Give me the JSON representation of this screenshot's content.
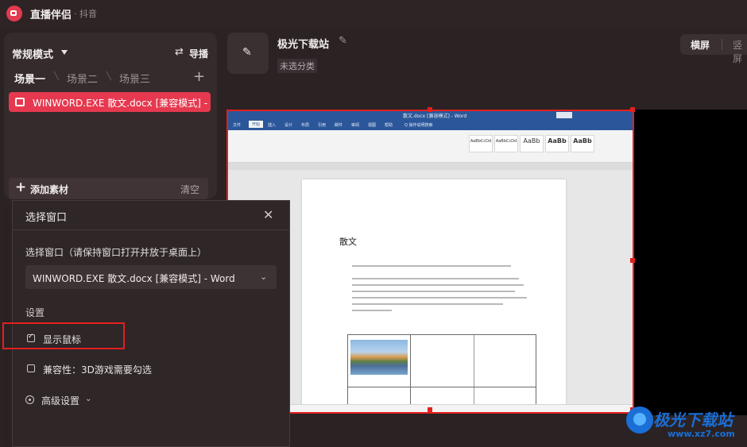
{
  "app": {
    "title": "直播伴侣",
    "platform": "· 抖音"
  },
  "mode": {
    "label": "常规模式"
  },
  "guide": {
    "label": "导播"
  },
  "scenes": [
    "场景一",
    "场景二",
    "场景三"
  ],
  "source": {
    "label": "WINWORD.EXE 散文.docx [兼容模式] - Word"
  },
  "add_bar": {
    "add_label": "添加素材",
    "clear_label": "清空"
  },
  "station": {
    "name": "极光下载站",
    "category": "未选分类"
  },
  "orientation": {
    "horizontal": "横屏",
    "vertical": "竖屏"
  },
  "word_preview": {
    "title": "散文.docx [兼容模式] - Word",
    "tabs": [
      "文件",
      "开始",
      "插入",
      "设计",
      "布局",
      "引用",
      "邮件",
      "审阅",
      "视图",
      "帮助",
      "Q 操作说明搜索"
    ],
    "styles": [
      "AaBbCcDd",
      "AaBbCcDd",
      "AaBb",
      "AaBb",
      "AaBb"
    ],
    "doc_title": "散文"
  },
  "dialog": {
    "title": "选择窗口",
    "select_label": "选择窗口（请保持窗口打开并放于桌面上）",
    "selected_window": "WINWORD.EXE 散文.docx [兼容模式] - Word",
    "settings_label": "设置",
    "show_cursor_label": "显示鼠标",
    "show_cursor_checked": true,
    "compat_label": "兼容性：3D游戏需要勾选",
    "compat_checked": false,
    "advanced_label": "高级设置"
  },
  "watermark": {
    "text": "极光下载站",
    "url": "www.xz7.com"
  },
  "colors": {
    "accent": "#e6394f",
    "highlight": "#e3201e",
    "word_blue": "#2b579a"
  }
}
